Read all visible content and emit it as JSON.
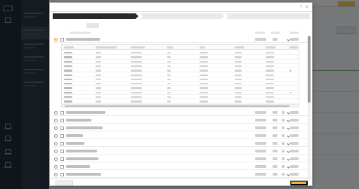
{
  "dialog": {
    "title": "",
    "steps": [
      {
        "label": "",
        "active": true
      },
      {
        "label": "",
        "active": false
      },
      {
        "label": "",
        "active": false
      }
    ],
    "tabs": [
      {
        "label": "",
        "active": false
      },
      {
        "label": "",
        "active": false
      },
      {
        "label": "",
        "active": true
      }
    ],
    "back_label": "",
    "next_label": ""
  },
  "colors": {
    "accent": "#eeb33f",
    "step_active_bg": "#2a2a2a",
    "selection": "#e2a12a"
  },
  "icons": {
    "header": [
      "help-icon",
      "close-icon"
    ],
    "row": [
      "radio-button",
      "checkbox",
      "chevron-down-icon"
    ]
  }
}
